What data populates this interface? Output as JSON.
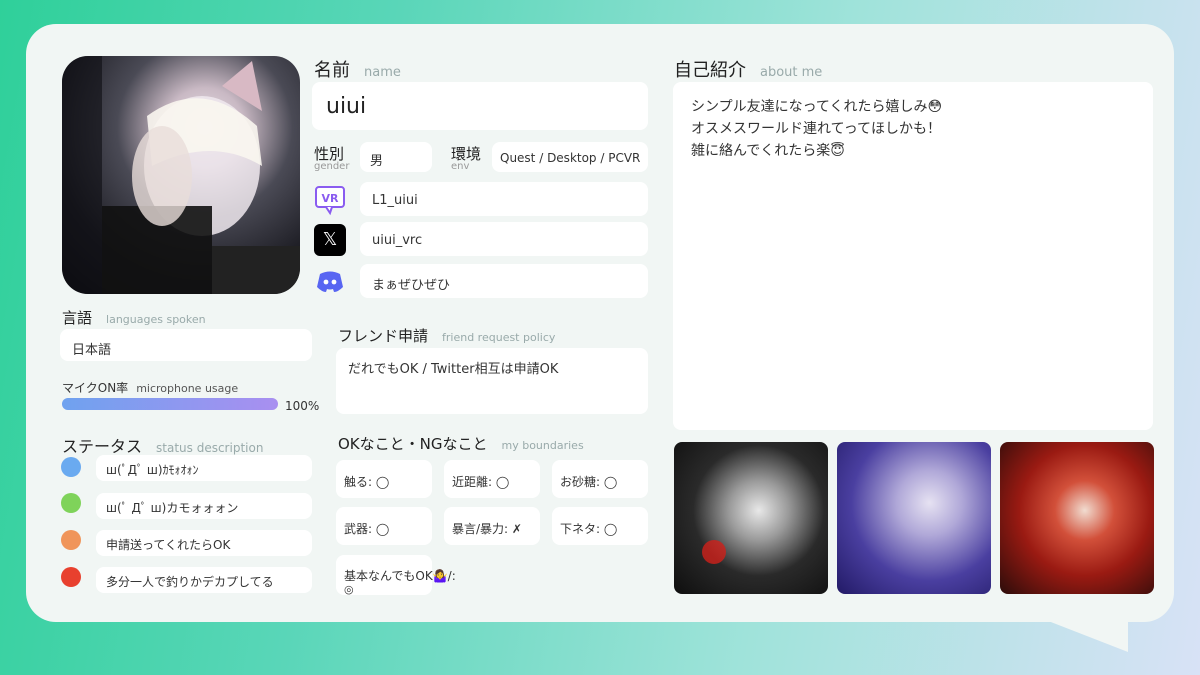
{
  "name": {
    "title": "名前",
    "sub": "name",
    "value": "uiui"
  },
  "gender": {
    "title": "性別",
    "sub": "gender",
    "value": "男"
  },
  "env": {
    "title": "環境",
    "sub": "env",
    "value": "Quest / Desktop / PCVR"
  },
  "vrchat": {
    "icon": "vrchat-icon",
    "value": "L1_uiui",
    "icon_text": "VR"
  },
  "x": {
    "icon": "x-logo-icon",
    "value": "uiui_vrc",
    "icon_text": "𝕏"
  },
  "discord": {
    "icon": "discord-icon",
    "value": "まぁぜひぜひ"
  },
  "about": {
    "title": "自己紹介",
    "sub": "about me",
    "lines": [
      "シンプル友達になってくれたら嬉しみ😳",
      "オスメスワールド連れてってほしかも！",
      "雑に絡んでくれたら楽😇"
    ]
  },
  "languages": {
    "title": "言語",
    "sub": "languages spoken",
    "value": "日本語"
  },
  "mic": {
    "title": "マイクON率",
    "sub": "microphone usage",
    "percent": 100,
    "label": "100%"
  },
  "status": {
    "title": "ステータス",
    "sub": "status description",
    "items": [
      {
        "color": "#6aaaf0",
        "text": "ш(ﾟДﾟ ш)ｶﾓｫｵｫﾝ"
      },
      {
        "color": "#7fd35a",
        "text": "ш(ﾟ Дﾟ ш)カモォォォン"
      },
      {
        "color": "#f0955a",
        "text": "申請送ってくれたらOK"
      },
      {
        "color": "#e8402e",
        "text": "多分一人で釣りかデカプしてる"
      }
    ]
  },
  "friend": {
    "title": "フレンド申請",
    "sub": "friend request policy",
    "value": "だれでもOK / Twitter相互は申請OK"
  },
  "boundaries": {
    "title": "OKなこと・NGなこと",
    "sub": "my boundaries",
    "items": [
      "触る: ◯",
      "近距離: ◯",
      "お砂糖: ◯",
      "武器: ◯",
      "暴言/暴力: ✗",
      "下ネタ: ◯"
    ],
    "note_line1": "基本なんでもOK🤷‍♀️/:",
    "note_line2": "◎"
  },
  "colors": {
    "accent_gradient_start": "#6fa2ef",
    "accent_gradient_end": "#a98ff0",
    "discord": "#5865f2",
    "vrchat": "#8a5cf0"
  }
}
